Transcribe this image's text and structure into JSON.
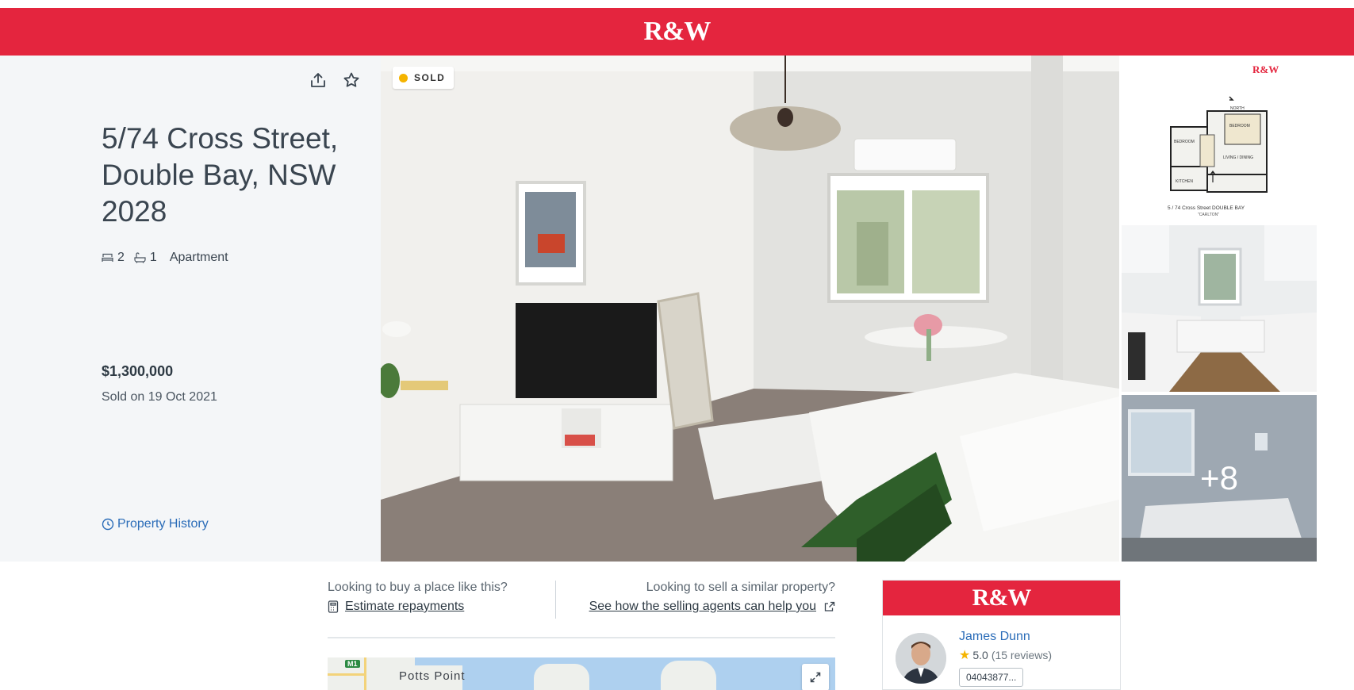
{
  "brand": {
    "logo_text": "R&W",
    "color": "#e4253e"
  },
  "listing": {
    "address": "5/74 Cross Street, Double Bay, NSW 2028",
    "bedrooms": "2",
    "bathrooms": "1",
    "property_type": "Apartment",
    "price": "$1,300,000",
    "sold_date": "Sold on 19 Oct 2021",
    "history_link": "Property History",
    "status_badge": "SOLD"
  },
  "actions": {
    "share_icon": "share-icon",
    "favourite_icon": "star-icon"
  },
  "gallery": {
    "more_count": "+8",
    "floorplan_caption": "5 / 74  Cross Street  DOUBLE BAY",
    "floorplan_subcaption": "\"CARLTON\"",
    "floorplan_labels": [
      "BEDROOM",
      "BEDROOM",
      "KITCHEN",
      "LIVING / DINING",
      "NORTH"
    ],
    "floorplan_logo": "R&W"
  },
  "cta": {
    "buy_question": "Looking to buy a place like this?",
    "buy_link": "Estimate repayments",
    "sell_question": "Looking to sell a similar property?",
    "sell_link": "See how the selling agents can help you"
  },
  "map": {
    "place_label": "Potts Point",
    "road_badge": "M1"
  },
  "agent": {
    "name": "James Dunn",
    "rating": "5.0",
    "reviews": "(15 reviews)",
    "phone": "04043877..."
  }
}
